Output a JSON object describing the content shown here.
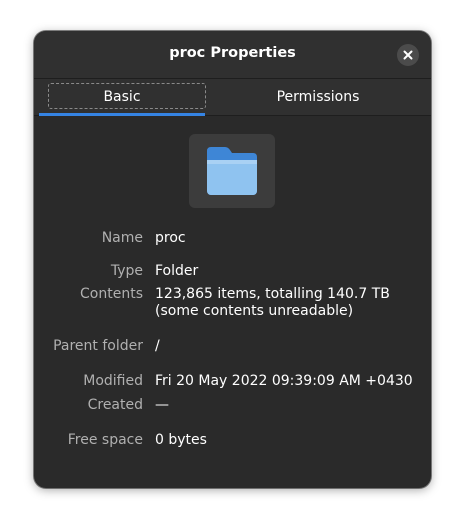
{
  "window": {
    "title": "proc Properties"
  },
  "header": {
    "close_icon": "close-icon"
  },
  "tabs": [
    {
      "label": "Basic",
      "active": true
    },
    {
      "label": "Permissions",
      "active": false
    }
  ],
  "icon": {
    "name": "folder-icon",
    "color": "#5aa0e0"
  },
  "properties": {
    "name_label": "Name",
    "name_value": "proc",
    "type_label": "Type",
    "type_value": "Folder",
    "contents_label": "Contents",
    "contents_value_line1": "123,865 items, totalling 140.7 TB",
    "contents_value_line2": "(some contents unreadable)",
    "parent_label": "Parent folder",
    "parent_value": "/",
    "modified_label": "Modified",
    "modified_value": "Fri 20 May 2022 09:39:09 AM +0430",
    "created_label": "Created",
    "created_value": "—",
    "freespace_label": "Free space",
    "freespace_value": "0 bytes"
  },
  "colors": {
    "accent": "#3584e4",
    "window_bg": "#2a2a2a",
    "header_bg": "#303030",
    "label_text": "#b0b0b0"
  }
}
